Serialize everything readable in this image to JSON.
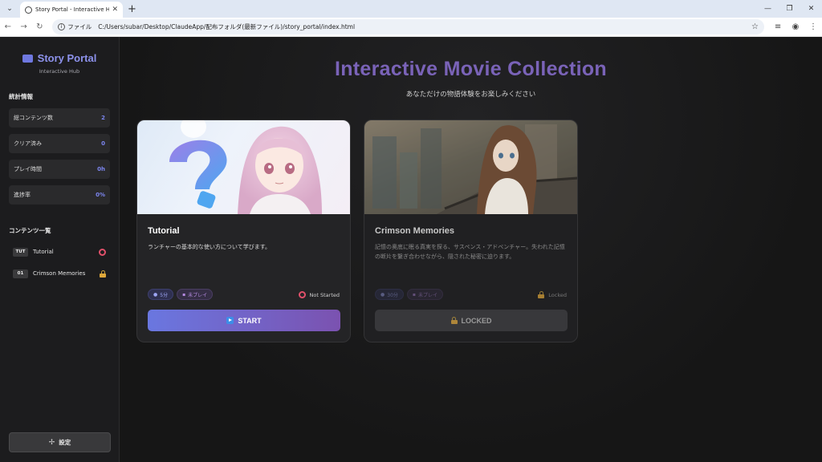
{
  "browser": {
    "tab_title": "Story Portal - Interactive Hub",
    "file_label": "ファイル",
    "url": "C:/Users/subar/Desktop/ClaudeApp/配布フォルダ(最新ファイル)/story_portal/index.html"
  },
  "sidebar": {
    "brand_title": "Story Portal",
    "brand_subtitle": "Interactive Hub",
    "stats_title": "統計情報",
    "stats": [
      {
        "label": "総コンテンツ数",
        "value": "2"
      },
      {
        "label": "クリア済み",
        "value": "0"
      },
      {
        "label": "プレイ時間",
        "value": "0h"
      },
      {
        "label": "進捗率",
        "value": "0%"
      }
    ],
    "contents_title": "コンテンツ一覧",
    "contents": [
      {
        "badge": "TUT",
        "name": "Tutorial"
      },
      {
        "badge": "01",
        "name": "Crimson Memories"
      }
    ],
    "settings_label": "設定"
  },
  "main": {
    "title": "Interactive Movie Collection",
    "subtitle": "あなただけの物語体験をお楽しみください",
    "cards": [
      {
        "title": "Tutorial",
        "description": "ランチャーの基本的な使い方について学びます。",
        "duration": "5分",
        "play_state": "未プレイ",
        "status": "Not Started",
        "button": "START"
      },
      {
        "title": "Crimson Memories",
        "description": "記憶の奥底に眠る真実を探る、サスペンス・アドベンチャー。失われた記憶の断片を繋ぎ合わせながら、隠された秘密に迫ります。",
        "duration": "30分",
        "play_state": "未プレイ",
        "status": "Locked",
        "button": "LOCKED"
      }
    ]
  },
  "colors": {
    "accent": "#7c86f0",
    "title_gradient_start": "#6a77e0",
    "title_gradient_end": "#7b52b0",
    "not_started_ring": "#e0506a",
    "lock": "#e0a83a"
  }
}
